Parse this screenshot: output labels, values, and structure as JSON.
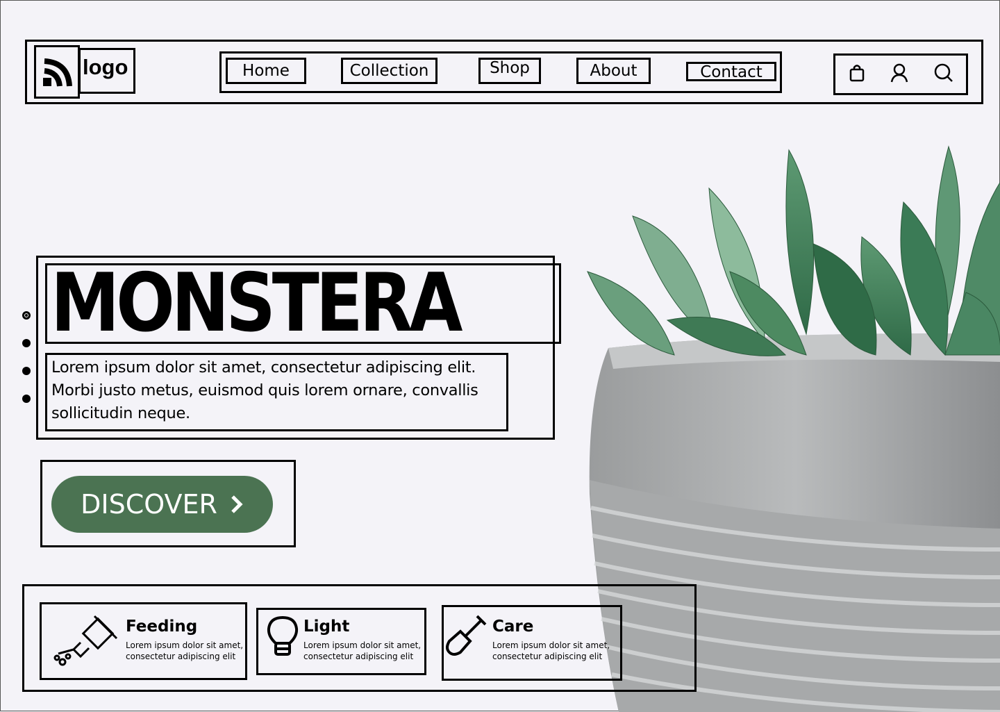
{
  "header": {
    "logo_text": "logo",
    "nav": [
      "Home",
      "Collection",
      "Shop",
      "About",
      "Contact"
    ],
    "actions": [
      "bag-icon",
      "user-icon",
      "search-icon"
    ]
  },
  "hero": {
    "title": "MONSTERA",
    "description": "Lorem ipsum dolor sit amet, consectetur adipiscing elit. Morbi justo metus, euismod quis lorem ornare, convallis sollicitudin neque.",
    "cta_label": "DISCOVER",
    "active_slide": 1,
    "slide_count": 4
  },
  "features": [
    {
      "title": "Feeding",
      "text": "Lorem ipsum dolor sit amet, consectetur adipiscing elit",
      "icon": "watering-can-icon"
    },
    {
      "title": "Light",
      "text": "Lorem ipsum dolor sit amet, consectetur adipiscing elit",
      "icon": "lightbulb-icon"
    },
    {
      "title": "Care",
      "text": "Lorem ipsum dolor sit amet, consectetur adipiscing elit",
      "icon": "shovel-icon"
    }
  ],
  "colors": {
    "background": "#f4f3f8",
    "accent": "#4b7352",
    "outline": "#000000"
  }
}
